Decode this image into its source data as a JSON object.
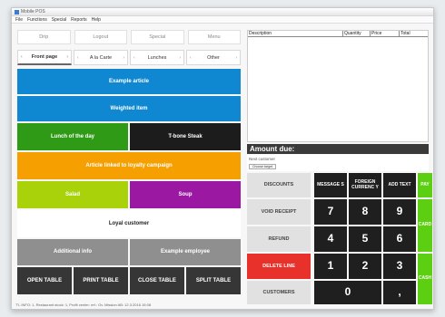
{
  "window": {
    "title": "Mobile POS"
  },
  "menubar": {
    "items": [
      "File",
      "Functions",
      "Special",
      "Reports",
      "Help"
    ]
  },
  "top_tabs": [
    "Drip",
    "Logout",
    "Special",
    "Menu"
  ],
  "sub_tabs": [
    "Front page",
    "A la Carte",
    "Lunches",
    "Other"
  ],
  "left_buttons": {
    "example_article": "Example article",
    "weighted_item": "Weighted item",
    "lunch_of_day": "Lunch of the day",
    "tbone_steak": "T-bone Steak",
    "loyalty_article": "Article linked to loyalty campaign",
    "salad": "Salad",
    "soup": "Soup",
    "loyal_customer": "Loyal customer",
    "additional_info": "Additional info",
    "example_employee": "Example employee",
    "open_table": "OPEN TABLE",
    "print_table": "PRINT TABLE",
    "close_table": "CLOSE TABLE",
    "split_table": "SPLIT TABLE"
  },
  "receipt": {
    "columns": [
      "Description",
      "Quantity",
      "Price",
      "Total"
    ]
  },
  "amount_due": {
    "label": "Amount due:"
  },
  "customer": {
    "label": "Next customer",
    "button": "Choose target"
  },
  "keypad": {
    "discounts": "DISCOUNTS",
    "message": "MESSAGE S",
    "foreign_currency": "FOREIGN CURRENC Y",
    "add_text": "ADD TEXT",
    "pay": "PAY",
    "void_receipt": "VOID RECEIPT",
    "refund": "REFUND",
    "delete_line": "DELETE LINE",
    "customers": "CUSTOMERS",
    "card": "CARD",
    "cash": "CASH",
    "digits": [
      "7",
      "8",
      "9",
      "4",
      "5",
      "6",
      "1",
      "2",
      "3",
      "0",
      ","
    ]
  },
  "status": {
    "text": "T'L INFO: 1, Restaurant stock: 1, Profit center: ref.: Ov. Mission AB: 12.3.2016 15:08"
  },
  "colors": {
    "blue": "#0f88d1",
    "green": "#2e9a16",
    "black": "#1c1c1c",
    "orange": "#f5a000",
    "lime": "#a9d20a",
    "purple": "#9a18a2",
    "grey": "#8f8f8f",
    "red": "#e8312a",
    "pay_green": "#5ccf12",
    "dark": "#363636"
  }
}
